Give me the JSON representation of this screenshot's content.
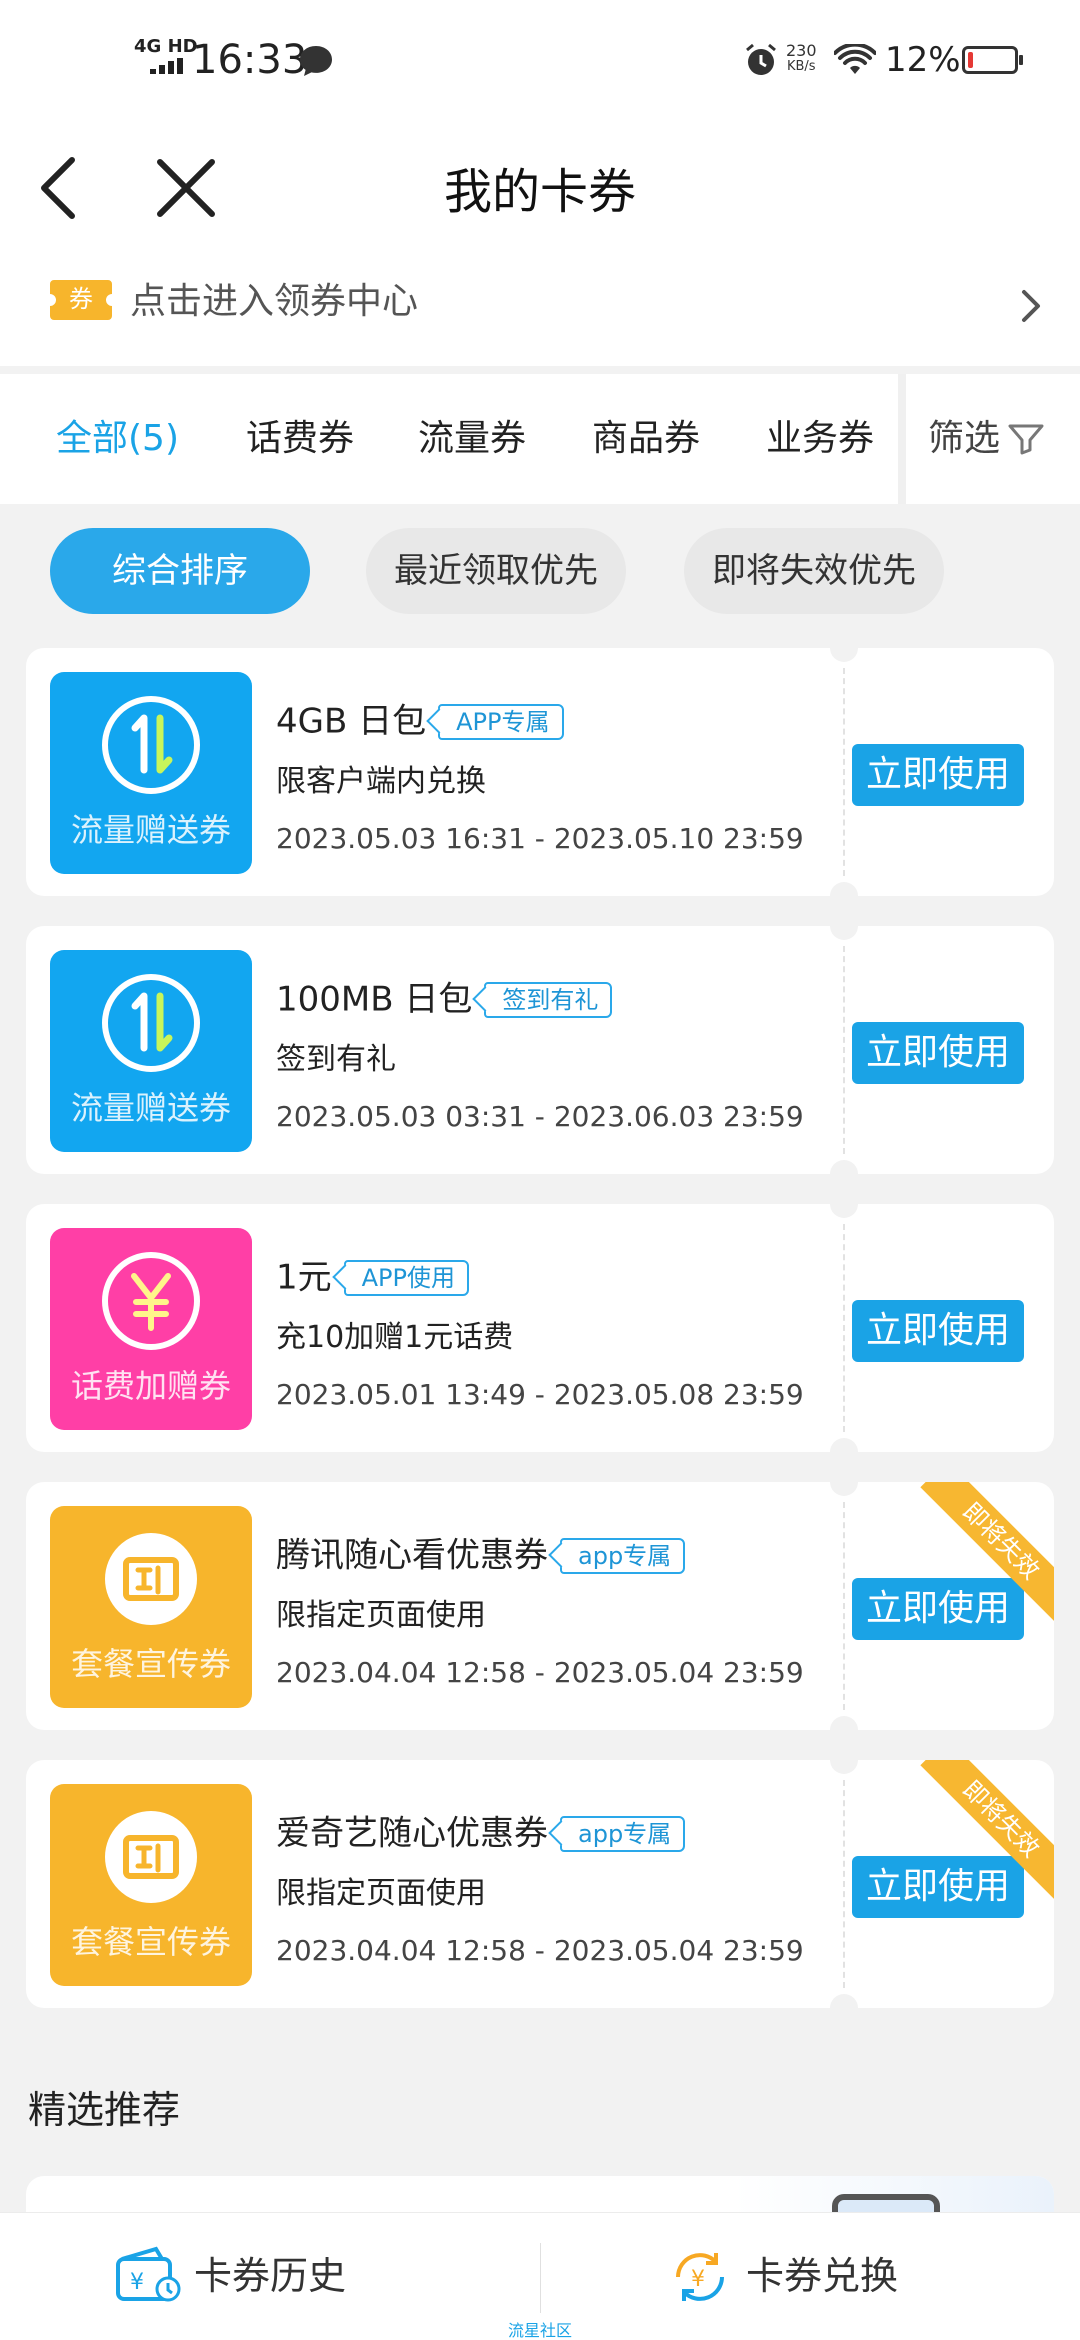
{
  "status_bar": {
    "network": "4G HD",
    "time": "16:33",
    "net_speed_value": "230",
    "net_speed_unit": "KB/s",
    "battery": "12%"
  },
  "header": {
    "title": "我的卡券",
    "back_icon": "chevron-left-icon",
    "close_icon": "close-icon"
  },
  "banner": {
    "icon_label": "券",
    "text": "点击进入领券中心"
  },
  "tabs": [
    {
      "label": "全部(5)",
      "active": true
    },
    {
      "label": "话费券",
      "active": false
    },
    {
      "label": "流量券",
      "active": false
    },
    {
      "label": "商品券",
      "active": false
    },
    {
      "label": "业务券",
      "active": false
    }
  ],
  "filter_label": "筛选",
  "sort_chips": [
    {
      "label": "综合排序",
      "active": true
    },
    {
      "label": "最近领取优先",
      "active": false
    },
    {
      "label": "即将失效优先",
      "active": false
    }
  ],
  "coupons": [
    {
      "thumb_label": "流量赠送券",
      "thumb_color": "#12a6f0",
      "icon": "data-transfer-icon",
      "title": "4GB 日包",
      "tag": "APP专属",
      "desc": "限客户端内兑换",
      "date": "2023.05.03 16:31 - 2023.05.10 23:59",
      "button": "立即使用"
    },
    {
      "thumb_label": "流量赠送券",
      "thumb_color": "#12a6f0",
      "icon": "data-transfer-icon",
      "title": "100MB 日包",
      "tag": "签到有礼",
      "desc": "签到有礼",
      "date": "2023.05.03 03:31 - 2023.06.03 23:59",
      "button": "立即使用"
    },
    {
      "thumb_label": "话费加赠券",
      "thumb_color": "#ff3fa6",
      "icon": "yuan-icon",
      "title": "1元",
      "tag": "APP使用",
      "desc": "充10加赠1元话费",
      "date": "2023.05.01 13:49 - 2023.05.08 23:59",
      "button": "立即使用"
    },
    {
      "thumb_label": "套餐宣传券",
      "thumb_color": "#f7b52c",
      "icon": "ticket-icon",
      "title": "腾讯随心看优惠券",
      "tag": "app专属",
      "desc": "限指定页面使用",
      "date": "2023.04.04 12:58 - 2023.05.04 23:59",
      "button": "立即使用",
      "ribbon": "即将失效"
    },
    {
      "thumb_label": "套餐宣传券",
      "thumb_color": "#f7b52c",
      "icon": "ticket-icon",
      "title": "爱奇艺随心优惠券",
      "tag": "app专属",
      "desc": "限指定页面使用",
      "date": "2023.04.04 12:58 - 2023.05.04 23:59",
      "button": "立即使用",
      "ribbon": "即将失效"
    }
  ],
  "recommend": {
    "title": "精选推荐"
  },
  "bottom_bar": {
    "history_label": "卡券历史",
    "exchange_label": "卡券兑换",
    "caption": "流星社区"
  },
  "colors": {
    "accent": "#1aa3e6",
    "ribbon": "#f7b731"
  }
}
